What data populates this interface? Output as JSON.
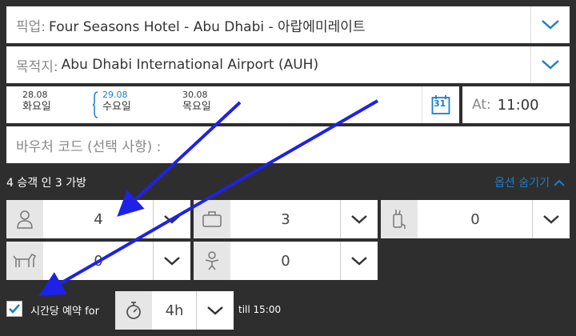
{
  "pickup": {
    "label": "픽업:",
    "value": "Four Seasons Hotel - Abu Dhabi - 아랍에미레이트"
  },
  "destination": {
    "label": "목적지:",
    "value": "Abu Dhabi International Airport (AUH)"
  },
  "dates": [
    {
      "date": "28.08",
      "weekday": "화요일",
      "selected": false
    },
    {
      "date": "29.08",
      "weekday": "수요일",
      "selected": true
    },
    {
      "date": "30.08",
      "weekday": "목요일",
      "selected": false
    }
  ],
  "calendar_day": "31",
  "time": {
    "label": "At:",
    "value": "11:00"
  },
  "voucher_placeholder": "바우처 코드 (선택 사항) :",
  "summary": "4 승객 인 3 가방",
  "hide_options_label": "옵션 숨기기",
  "passengers": "4",
  "bags": "3",
  "golf_bags": "0",
  "pets": "0",
  "infants": "0",
  "hourly": {
    "checked": true,
    "label": "시간당 예약 for",
    "hours": "4h",
    "till": "till 15:00"
  },
  "colors": {
    "accent": "#1a7fc7",
    "background": "#2e2e2e",
    "arrow": "#1e22e6"
  }
}
